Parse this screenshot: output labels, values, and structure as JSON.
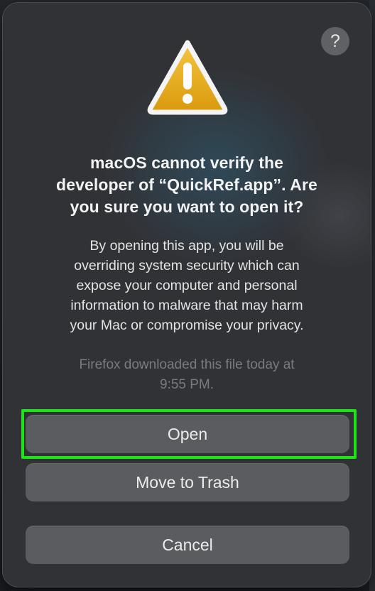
{
  "dialog": {
    "help_label": "?",
    "icon": "warning-triangle-icon",
    "title_lines": [
      "macOS cannot verify the",
      "developer of “QuickRef.app”. Are",
      "you sure you want to open it?"
    ],
    "body_lines": [
      "By opening this app, you will be",
      "overriding system security which can",
      "expose your computer and personal",
      "information to malware that may harm",
      "your Mac or compromise your privacy."
    ],
    "source_note_lines": [
      "Firefox downloaded this file today at",
      "9:55 PM."
    ],
    "buttons": {
      "open": "Open",
      "move_to_trash": "Move to Trash",
      "cancel": "Cancel"
    },
    "highlight_color": "#1fe21b",
    "icon_colors": {
      "fill_top": "#f5c542",
      "fill_bottom": "#d99a0c",
      "stroke": "#f4f4f4"
    }
  }
}
